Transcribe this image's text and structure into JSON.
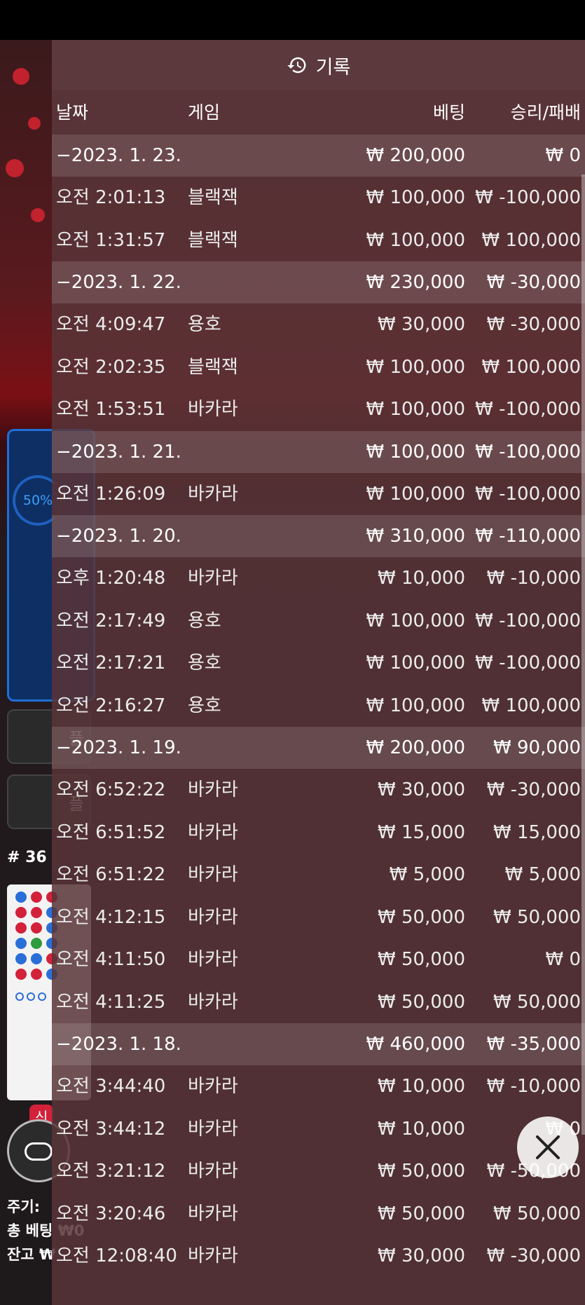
{
  "panel": {
    "title": "기록",
    "columns": {
      "date": "날짜",
      "game": "게임",
      "bet": "베팅",
      "result": "승리/패배"
    }
  },
  "groups": [
    {
      "date": "−2023. 1. 23.",
      "bet_total": "₩ 200,000",
      "result_total": "₩ 0",
      "entries": [
        {
          "time": "오전 2:01:13",
          "game": "블랙잭",
          "bet": "₩ 100,000",
          "result": "₩ -100,000"
        },
        {
          "time": "오전 1:31:57",
          "game": "블랙잭",
          "bet": "₩ 100,000",
          "result": "₩ 100,000"
        }
      ]
    },
    {
      "date": "−2023. 1. 22.",
      "bet_total": "₩ 230,000",
      "result_total": "₩ -30,000",
      "entries": [
        {
          "time": "오전 4:09:47",
          "game": "용호",
          "bet": "₩ 30,000",
          "result": "₩ -30,000"
        },
        {
          "time": "오전 2:02:35",
          "game": "블랙잭",
          "bet": "₩ 100,000",
          "result": "₩ 100,000"
        },
        {
          "time": "오전 1:53:51",
          "game": "바카라",
          "bet": "₩ 100,000",
          "result": "₩ -100,000"
        }
      ]
    },
    {
      "date": "−2023. 1. 21.",
      "bet_total": "₩ 100,000",
      "result_total": "₩ -100,000",
      "entries": [
        {
          "time": "오전 1:26:09",
          "game": "바카라",
          "bet": "₩ 100,000",
          "result": "₩ -100,000"
        }
      ]
    },
    {
      "date": "−2023. 1. 20.",
      "bet_total": "₩ 310,000",
      "result_total": "₩ -110,000",
      "entries": [
        {
          "time": "오후 1:20:48",
          "game": "바카라",
          "bet": "₩ 10,000",
          "result": "₩ -10,000"
        },
        {
          "time": "오전 2:17:49",
          "game": "용호",
          "bet": "₩ 100,000",
          "result": "₩ -100,000"
        },
        {
          "time": "오전 2:17:21",
          "game": "용호",
          "bet": "₩ 100,000",
          "result": "₩ -100,000"
        },
        {
          "time": "오전 2:16:27",
          "game": "용호",
          "bet": "₩ 100,000",
          "result": "₩ 100,000"
        }
      ]
    },
    {
      "date": "−2023. 1. 19.",
      "bet_total": "₩ 200,000",
      "result_total": "₩ 90,000",
      "entries": [
        {
          "time": "오전 6:52:22",
          "game": "바카라",
          "bet": "₩ 30,000",
          "result": "₩ -30,000"
        },
        {
          "time": "오전 6:51:52",
          "game": "바카라",
          "bet": "₩ 15,000",
          "result": "₩ 15,000"
        },
        {
          "time": "오전 6:51:22",
          "game": "바카라",
          "bet": "₩ 5,000",
          "result": "₩ 5,000"
        },
        {
          "time": "오전 4:12:15",
          "game": "바카라",
          "bet": "₩ 50,000",
          "result": "₩ 50,000"
        },
        {
          "time": "오전 4:11:50",
          "game": "바카라",
          "bet": "₩ 50,000",
          "result": "₩ 0"
        },
        {
          "time": "오전 4:11:25",
          "game": "바카라",
          "bet": "₩ 50,000",
          "result": "₩ 50,000"
        }
      ]
    },
    {
      "date": "−2023. 1. 18.",
      "bet_total": "₩ 460,000",
      "result_total": "₩ -35,000",
      "entries": [
        {
          "time": "오전 3:44:40",
          "game": "바카라",
          "bet": "₩ 10,000",
          "result": "₩ -10,000"
        },
        {
          "time": "오전 3:44:12",
          "game": "바카라",
          "bet": "₩ 10,000",
          "result": "₩ 0"
        },
        {
          "time": "오전 3:21:12",
          "game": "바카라",
          "bet": "₩ 50,000",
          "result": "₩ -50,000"
        },
        {
          "time": "오전 3:20:46",
          "game": "바카라",
          "bet": "₩ 50,000",
          "result": "₩ 50,000"
        },
        {
          "time": "오전 12:08:40",
          "game": "바카라",
          "bet": "₩ 30,000",
          "result": "₩ -30,000"
        }
      ]
    }
  ],
  "background": {
    "stats_percent": "50%",
    "buttons": [
      "플",
      "플"
    ],
    "round_number": "# 36",
    "new_badge": "신",
    "info_lines": [
      "주기: ",
      "총 베팅 ₩0",
      "잔고 ₩"
    ]
  },
  "colors": {
    "panel_bg": "#583438",
    "accent_blue": "#1f6fd8",
    "banker_red": "#d3213a",
    "player_blue": "#2a6fd8",
    "tie_green": "#2e9b3e"
  },
  "icons": {
    "header": "history-icon",
    "close": "close-icon"
  }
}
